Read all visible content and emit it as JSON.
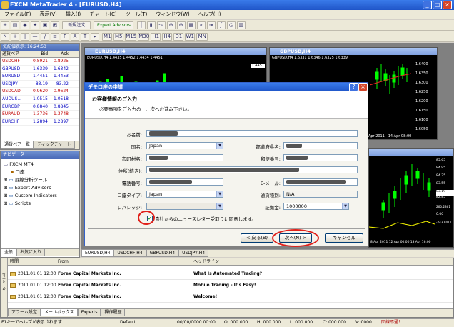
{
  "window": {
    "title": "FXCM MetaTrader 4 - [EURUSD,H4]"
  },
  "menu": [
    "ファイル(F)",
    "表示(V)",
    "挿入(I)",
    "チャート(C)",
    "ツール(T)",
    "ウィンドウ(W)",
    "ヘルプ(H)"
  ],
  "toolbar": {
    "new_order": "新規注文",
    "expert_advisors": "Expert Advisors"
  },
  "market_watch": {
    "title": "気配値表示: 16:24:53",
    "columns": [
      "通貨ペア",
      "Bid",
      "Ask"
    ],
    "rows": [
      {
        "sym": "USDCHF",
        "bid": "0.8921",
        "ask": "0.8925",
        "color": "#c00000"
      },
      {
        "sym": "GBPUSD",
        "bid": "1.6339",
        "ask": "1.6342",
        "color": "#0000c0"
      },
      {
        "sym": "EURUSD",
        "bid": "1.4451",
        "ask": "1.4453",
        "color": "#0000c0"
      },
      {
        "sym": "USDJPY",
        "bid": "83.19",
        "ask": "83.22",
        "color": "#0000c0"
      },
      {
        "sym": "USDCAD",
        "bid": "0.9620",
        "ask": "0.9624",
        "color": "#c00000"
      },
      {
        "sym": "AUDUS...",
        "bid": "1.0515",
        "ask": "1.0518",
        "color": "#0000c0"
      },
      {
        "sym": "EURGBP",
        "bid": "0.8840",
        "ask": "0.8845",
        "color": "#0000c0"
      },
      {
        "sym": "EURAUD",
        "bid": "1.3736",
        "ask": "1.3748",
        "color": "#c00000"
      },
      {
        "sym": "EURCHF",
        "bid": "1.2894",
        "ask": "1.2897",
        "color": "#0000c0"
      }
    ],
    "tabs": [
      "通貨ペア一覧",
      "ティックチャート"
    ]
  },
  "navigator": {
    "title": "ナビゲーター",
    "root": "FXCM MT4",
    "items": [
      "口座",
      "罫線分析ツール",
      "Expert Advisors",
      "Custom Indicators",
      "Scripts"
    ],
    "tabs": [
      "全般",
      "お気に入り"
    ]
  },
  "charts": {
    "eurusd": {
      "title": "EURUSD,H4",
      "info": "EURUSD,H4  1.4435  1.4452  1.4434  1.4451",
      "price": "1.4451"
    },
    "gbpusd": {
      "title": "GBPUSD,H4",
      "info": "GBPUSD,H4  1.6331  1.6346  1.6325  1.6339",
      "prices": [
        "1.6400",
        "1.6350",
        "1.6300",
        "1.6250",
        "1.6200",
        "1.6150",
        "1.6100",
        "1.6050"
      ],
      "dates": [
        "13 Apr 2011",
        "14 Apr 08:00"
      ]
    },
    "third": {
      "prices": [
        "85.65",
        "84.95",
        "84.25",
        "83.55",
        "83.19",
        "82.85",
        "260.2861",
        "0.00",
        "-243.8411"
      ],
      "dates": [
        "8 Apr 2011",
        "12 Apr 00:00",
        "13 Apr 16:00"
      ]
    },
    "tabs": [
      "EURUSD,H4",
      "USDCHF,H4",
      "GBPUSD,H4",
      "USDJPY,H4"
    ]
  },
  "dialog": {
    "title": "デモ口座の申請",
    "heading": "お客様情報のご入力",
    "subheading": "必要事項をご入力の上、次へお進み下さい。",
    "labels": {
      "name": "お名前:",
      "country": "国名:",
      "prefecture": "都道府県名:",
      "city": "市町村名:",
      "zip": "郵便番号:",
      "address": "住所(続き):",
      "phone": "電話番号:",
      "email": "E-メール:",
      "account_type": "口座タイプ:",
      "currency": "通貨種別:",
      "leverage": "レバレッジ:",
      "deposit": "証拠金:"
    },
    "values": {
      "country": "Japan",
      "account_type": "Japan",
      "currency": "N/A",
      "deposit": "1000000"
    },
    "checkbox": "貴社からのニュースレター受取りに同意します。",
    "buttons": {
      "back": "< 戻る(B)",
      "next": "次へ(N) >",
      "cancel": "キャンセル"
    }
  },
  "terminal": {
    "columns": [
      "時間",
      "From",
      "ヘッドライン"
    ],
    "rows": [
      {
        "time": "2011.01.01 12:00",
        "from": "Forex Capital Markets Inc.",
        "headline": "What Is Automated Trading?"
      },
      {
        "time": "2011.01.01 12:00",
        "from": "Forex Capital Markets Inc.",
        "headline": "Mobile Trading - It's Easy!"
      },
      {
        "time": "2011.01.01 12:00",
        "from": "Forex Capital Markets Inc.",
        "headline": "Welcome!"
      }
    ],
    "side_label": "ターミナル",
    "tabs": [
      "アラーム設定",
      "メールボックス",
      "Experts",
      "操作履歴"
    ]
  },
  "status": {
    "help": "F1キーでヘルプが表示されます",
    "profile": "Default",
    "datetime": "00/00/0000 00:00",
    "o": "O: 000.000",
    "h": "H: 000.000",
    "l": "L: 000.000",
    "c": "C: 000.000",
    "v": "V: 0000",
    "conn": "回線不通！"
  }
}
